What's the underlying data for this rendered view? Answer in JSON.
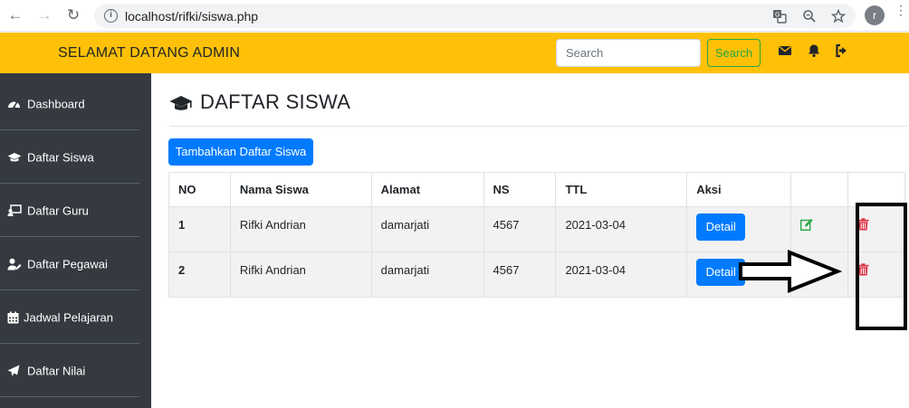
{
  "browser": {
    "url": "localhost/rifki/siswa.php",
    "profile_initial": "r",
    "back_icon": "arrow-left-icon",
    "forward_icon": "arrow-right-icon",
    "reload_icon": "reload-icon"
  },
  "navbar": {
    "brand": "SELAMAT DATANG ADMIN",
    "search_placeholder": "Search",
    "search_button": "Search",
    "icons": [
      "envelope-icon",
      "bell-icon",
      "sign-out-icon"
    ],
    "color": "#ffc107"
  },
  "sidebar": {
    "items": [
      {
        "label": "Dashboard",
        "icon": "tachometer-icon"
      },
      {
        "label": "Daftar Siswa",
        "icon": "graduation-cap-icon"
      },
      {
        "label": "Daftar Guru",
        "icon": "chalkboard-teacher-icon"
      },
      {
        "label": "Daftar Pegawai",
        "icon": "user-edit-icon"
      },
      {
        "label": "Jadwal Pelajaran",
        "icon": "calendar-icon"
      },
      {
        "label": "Daftar Nilai",
        "icon": "paper-plane-icon"
      }
    ],
    "color": "#343a40"
  },
  "main": {
    "title": "DAFTAR SISWA",
    "add_button": "Tambahkan Daftar Siswa",
    "table": {
      "headers": [
        "NO",
        "Nama Siswa",
        "Alamat",
        "NS",
        "TTL",
        "Aksi"
      ],
      "rows": [
        {
          "no": "1",
          "nama": "Rifki Andrian",
          "alamat": "damarjati",
          "ns": "4567",
          "ttl": "2021-03-04",
          "detail": "Detail"
        },
        {
          "no": "2",
          "nama": "Rifki Andrian",
          "alamat": "damarjati",
          "ns": "4567",
          "ttl": "2021-03-04",
          "detail": "Detail"
        }
      ]
    },
    "colors": {
      "primary": "#007bff",
      "edit": "#28a745",
      "delete": "#dc3545"
    }
  }
}
